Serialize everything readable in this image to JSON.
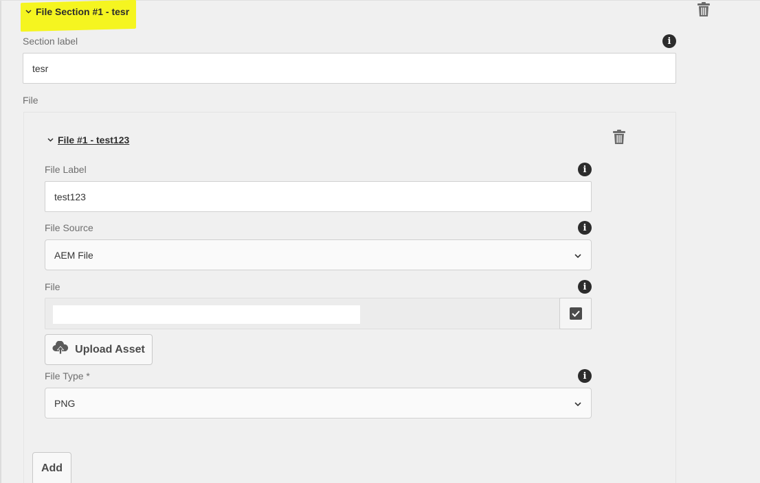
{
  "section": {
    "title": "File Section #1 - tesr",
    "label_caption": "Section label",
    "label_value": "tesr",
    "file_caption": "File"
  },
  "file_item": {
    "title": "File #1 - test123",
    "label_caption": "File Label",
    "label_value": "test123",
    "source_caption": "File Source",
    "source_value": "AEM File",
    "file_caption": "File",
    "file_value": "",
    "upload_label": "Upload Asset",
    "type_caption": "File Type *",
    "type_value": "PNG"
  },
  "add_label": "Add",
  "icons": {
    "info": "i",
    "trash": "trash-icon",
    "upload": "cloud-upload-icon",
    "chevron": "chevron-down-icon",
    "check": "checkmark-icon"
  },
  "colors": {
    "highlight": "#f5f520",
    "background": "#f0f0f0",
    "text": "#4b4b4b"
  }
}
